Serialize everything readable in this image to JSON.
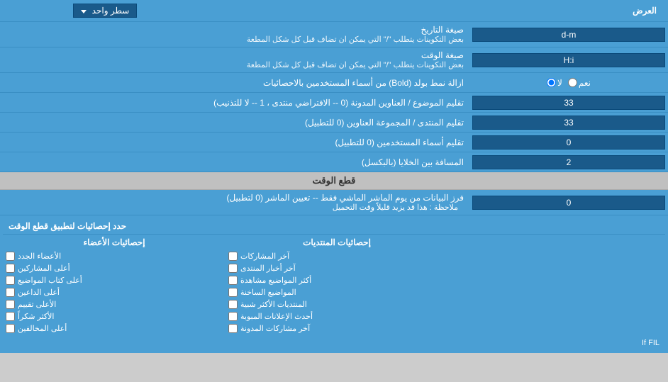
{
  "header": {
    "label": "العرض",
    "dropdown_label": "سطر واحد"
  },
  "rows": [
    {
      "id": "date_format",
      "label": "صيغة التاريخ\nبعض التكوينات يتطلب \"/\" التي يمكن ان تضاف قبل كل شكل المطعة",
      "label_line1": "صيغة التاريخ",
      "label_line2": "بعض التكوينات يتطلب \"/\" التي يمكن ان تضاف قبل كل شكل المطعة",
      "value": "d-m",
      "type": "text"
    },
    {
      "id": "time_format",
      "label_line1": "صيغة الوقت",
      "label_line2": "بعض التكوينات يتطلب \"/\" التي يمكن ان تضاف قبل كل شكل المطعة",
      "value": "H:i",
      "type": "text"
    },
    {
      "id": "bold_remove",
      "label_line1": "ازالة نمط بولد (Bold) من أسماء المستخدمين بالاحصائيات",
      "label_line2": "",
      "value": "",
      "type": "radio",
      "radio_yes": "نعم",
      "radio_no": "لا",
      "selected": "no"
    },
    {
      "id": "subject_titles",
      "label_line1": "تقليم الموضوع / العناوين المدونة (0 -- الافتراضي منتدى ، 1 -- لا للتذنيب)",
      "label_line2": "",
      "value": "33",
      "type": "text"
    },
    {
      "id": "forum_titles",
      "label_line1": "تقليم المنتدى / المجموعة العناوين (0 للتطبيل)",
      "label_line2": "",
      "value": "33",
      "type": "text"
    },
    {
      "id": "user_names",
      "label_line1": "تقليم أسماء المستخدمين (0 للتطبيل)",
      "label_line2": "",
      "value": "0",
      "type": "text"
    },
    {
      "id": "cell_spacing",
      "label_line1": "المسافة بين الخلايا (بالبكسل)",
      "label_line2": "",
      "value": "2",
      "type": "text"
    }
  ],
  "time_cut_section": {
    "header": "قطع الوقت",
    "row": {
      "label_line1": "فرز البيانات من يوم الماشر الماشي فقط -- تعيين الماشر (0 لتطبيل)",
      "label_line2": "ملاحظة : هذا قد يزيد قليلاً وقت التحميل",
      "value": "0"
    }
  },
  "checkboxes": {
    "header": "حدد إحصائيات لتطبيق قطع الوقت",
    "col1_header": "إحصائيات الأعضاء",
    "col2_header": "إحصائيات المنتديات",
    "col3_header": "",
    "col1_items": [
      "الأعضاء الجدد",
      "أعلى المشاركين",
      "أعلى كتاب المواضيع",
      "أعلى الداعين",
      "الأعلى تقييم",
      "الأكثر شكراً",
      "أعلى المخالفين"
    ],
    "col2_items": [
      "آخر المشاركات",
      "آخر أخبار المنتدى",
      "أكثر المواضيع مشاهدة",
      "المواضيع الساخنة",
      "المنتديات الأكثر شبية",
      "أحدث الإعلانات المبوبة",
      "آخر مشاركات المدونة"
    ],
    "col3_items": []
  },
  "bottom_text": "If FIL"
}
